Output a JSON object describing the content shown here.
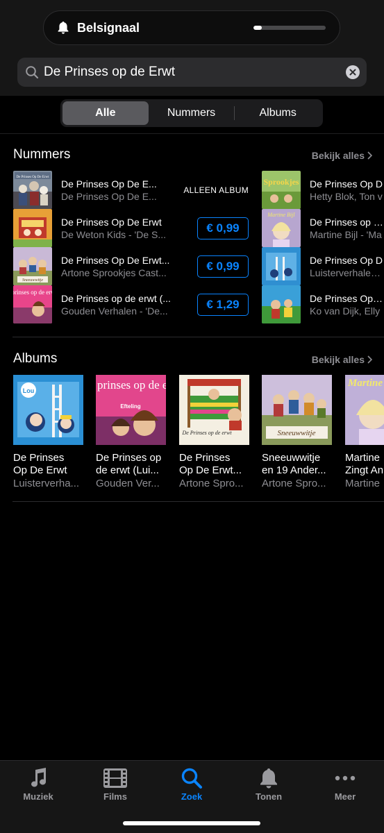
{
  "banner": {
    "title": "Belsignaal",
    "icon": "bell-icon",
    "volume_level": 0.12
  },
  "search": {
    "query": "De Prinses op de Erwt",
    "icon": "search-icon"
  },
  "segments": {
    "items": [
      "Alle",
      "Nummers",
      "Albums"
    ],
    "selected": "Alle"
  },
  "songs": {
    "title": "Nummers",
    "see_all": "Bekijk alles",
    "left": [
      {
        "title": "De Prinses Op De E...",
        "subtitle": "De Prinses Op De E...",
        "action": "ALLEEN ALBUM"
      },
      {
        "title": "De Prinses Op De Erwt",
        "subtitle": "De Weton Kids - 'De S...",
        "action": "€ 0,99"
      },
      {
        "title": "De Prinses Op De Erwt...",
        "subtitle": "Artone Sprookjes Cast...",
        "action": "€ 0,99"
      },
      {
        "title": "De Prinses op de erwt (...",
        "subtitle": "Gouden Verhalen - 'De...",
        "action": "€ 1,29"
      }
    ],
    "right": [
      {
        "title": "De Prinses Op D",
        "subtitle": "Hetty Blok, Ton v"
      },
      {
        "title": "De Prinses op de",
        "subtitle": "Martine Bijl - 'Ma"
      },
      {
        "title": "De Prinses Op D",
        "subtitle": "Luisterverhalen L"
      },
      {
        "title": "De Prinses Op de",
        "subtitle": "Ko van Dijk, Elly"
      }
    ]
  },
  "albums": {
    "title": "Albums",
    "see_all": "Bekijk alles",
    "items": [
      {
        "line1": "De Prinses",
        "line2": "Op De Erwt",
        "artist": "Luisterverha..."
      },
      {
        "line1": "De Prinses op",
        "line2": "de erwt (Lui...",
        "artist": "Gouden Ver..."
      },
      {
        "line1": "De Prinses",
        "line2": "Op De Erwt...",
        "artist": "Artone Spro..."
      },
      {
        "line1": "Sneeuwwitje",
        "line2": "en 19 Ander...",
        "artist": "Artone Spro..."
      },
      {
        "line1": "Martine",
        "line2": "Zingt An",
        "artist": "Martine"
      }
    ]
  },
  "covers": {
    "song_l1": "De Prinses Op De Erwt",
    "song_l3": "Sneeuwwitje",
    "song_l4": "De prinses op de erwt",
    "song_r1": "Sprookjes",
    "song_r2": "Martine Bijl",
    "album_lou": "Lou",
    "album_gouden_title": "De prinses op de erwt",
    "album_gouden_brand": "Efteling",
    "album_artone": "De Prinses op de erwt",
    "album_sneeuw": "Sneeuwwitje",
    "album_martine": "Martine"
  },
  "tabs": [
    {
      "label": "Muziek",
      "icon": "music-note-icon"
    },
    {
      "label": "Films",
      "icon": "film-icon"
    },
    {
      "label": "Zoek",
      "icon": "search-icon",
      "active": true
    },
    {
      "label": "Tonen",
      "icon": "bell-icon"
    },
    {
      "label": "Meer",
      "icon": "more-dots-icon"
    }
  ],
  "colors": {
    "accent": "#0a84ff",
    "background": "#000000",
    "secondary_text": "#8e8e93"
  }
}
